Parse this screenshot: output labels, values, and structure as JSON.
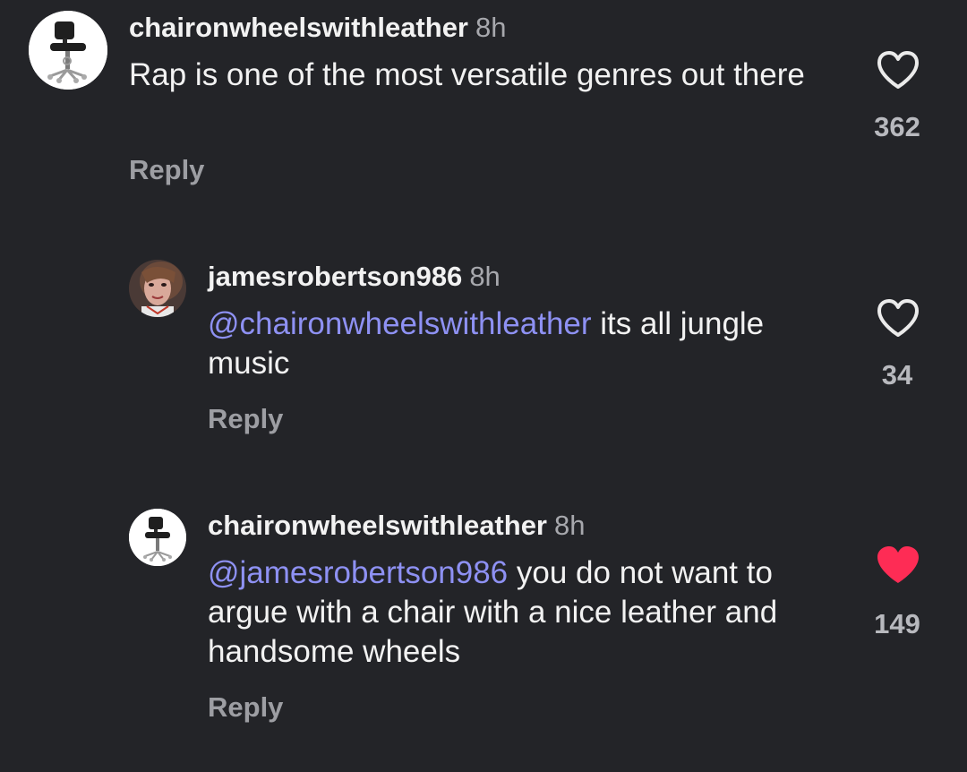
{
  "comments": [
    {
      "username": "chaironwheelswithleather",
      "time": "8h",
      "mention": "",
      "text": "Rap is one of the most versatile genres out there",
      "likes": "362",
      "liked": false,
      "reply_label": "Reply",
      "avatar_icon": "office-chair-avatar"
    },
    {
      "username": "jamesrobertson986",
      "time": "8h",
      "mention": "@chaironwheelswithleather",
      "text": "its all jungle music",
      "likes": "34",
      "liked": false,
      "reply_label": "Reply",
      "avatar_icon": "person-photo-avatar"
    },
    {
      "username": "chaironwheelswithleather",
      "time": "8h",
      "mention": "@jamesrobertson986",
      "text": "you do not want to argue with a chair with a nice leather and handsome wheels",
      "likes": "149",
      "liked": true,
      "reply_label": "Reply",
      "avatar_icon": "office-chair-avatar"
    }
  ],
  "colors": {
    "background": "#232428",
    "mention": "#8e91f3",
    "liked_heart": "#fe2c55",
    "timestamp": "#a7a8ad"
  }
}
